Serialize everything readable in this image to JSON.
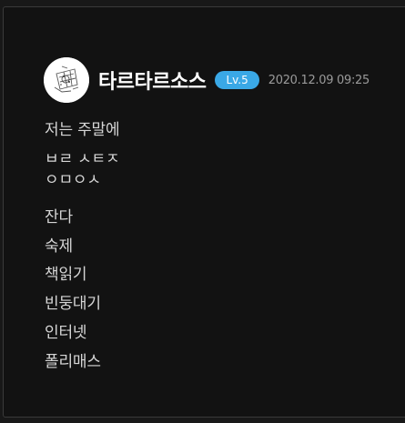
{
  "post": {
    "author": "타르타르소스",
    "level": "Lv.5",
    "timestamp": "2020.12.09 09:25",
    "lines": [
      "저는 주말에",
      "ㅂㄹ ㅅㅌㅈ",
      "ㅇㅁㅇㅅ",
      "잔다",
      "숙제",
      "책읽기",
      "빈둥대기",
      "인터넷",
      "폴리매스"
    ]
  },
  "colors": {
    "badge": "#3aa8e6",
    "background": "#121212",
    "text": "#d6d6d6"
  },
  "icons": {
    "avatar": "sketch-avatar-icon"
  }
}
